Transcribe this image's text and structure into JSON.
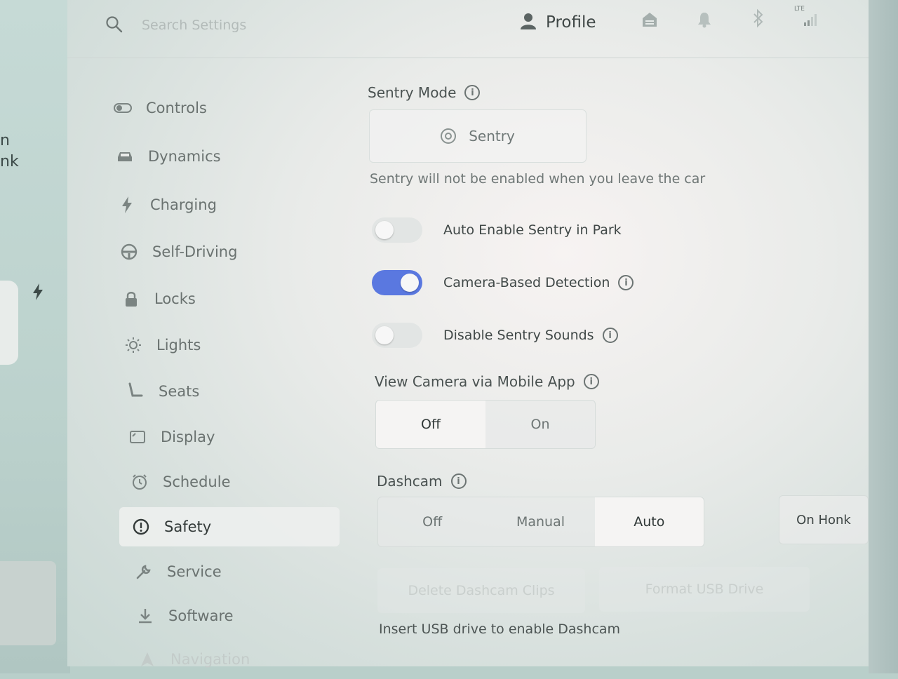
{
  "left_fragments": [
    "n",
    "nk"
  ],
  "topbar": {
    "search_placeholder": "Search Settings",
    "profile_label": "Profile",
    "icons": [
      "garage-icon",
      "bell-icon",
      "bluetooth-icon",
      "lte-signal-icon"
    ],
    "network": "LTE"
  },
  "sidebar": {
    "items": [
      {
        "label": "Controls",
        "icon": "toggle-icon"
      },
      {
        "label": "Dynamics",
        "icon": "car-icon"
      },
      {
        "label": "Charging",
        "icon": "bolt-icon"
      },
      {
        "label": "Self-Driving",
        "icon": "steering-wheel-icon"
      },
      {
        "label": "Locks",
        "icon": "lock-icon"
      },
      {
        "label": "Lights",
        "icon": "sun-icon"
      },
      {
        "label": "Seats",
        "icon": "seat-icon"
      },
      {
        "label": "Display",
        "icon": "display-icon"
      },
      {
        "label": "Schedule",
        "icon": "alarm-clock-icon"
      },
      {
        "label": "Safety",
        "icon": "alert-circle-icon",
        "active": true
      },
      {
        "label": "Service",
        "icon": "wrench-icon"
      },
      {
        "label": "Software",
        "icon": "download-icon"
      },
      {
        "label": "Navigation",
        "icon": "navigation-icon"
      }
    ]
  },
  "main": {
    "sentry_mode": {
      "title": "Sentry Mode",
      "button_label": "Sentry",
      "note": "Sentry will not be enabled when you leave the car"
    },
    "toggles": [
      {
        "label": "Auto Enable Sentry in Park",
        "on": false,
        "info": false
      },
      {
        "label": "Camera-Based Detection",
        "on": true,
        "info": true
      },
      {
        "label": "Disable Sentry Sounds",
        "on": false,
        "info": true
      }
    ],
    "view_camera": {
      "title": "View Camera via Mobile App",
      "options": [
        "Off",
        "On"
      ],
      "selected": "Off"
    },
    "dashcam": {
      "title": "Dashcam",
      "options": [
        "Off",
        "Manual",
        "Auto"
      ],
      "selected": "Auto",
      "on_honk_label": "On Honk",
      "delete_label": "Delete Dashcam Clips",
      "format_label": "Format USB Drive",
      "note": "Insert USB drive to enable Dashcam"
    }
  },
  "colors": {
    "toggle_on": "#5a78e0",
    "toggle_off": "#e2e5e4",
    "text_primary": "#404847"
  }
}
